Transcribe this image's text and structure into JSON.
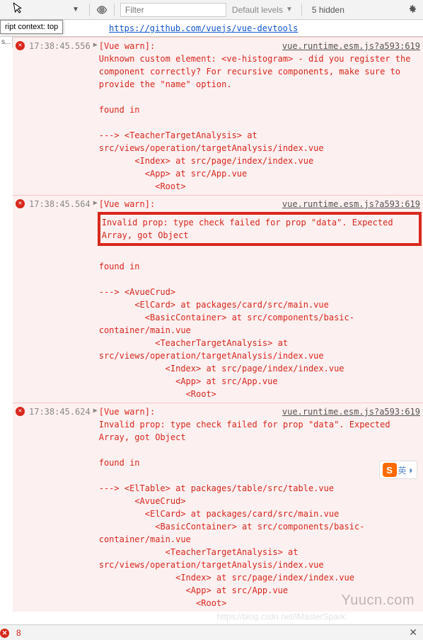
{
  "toolbar": {
    "filter_placeholder": "Filter",
    "levels_label": "Default levels",
    "hidden_label": "5 hidden"
  },
  "context": {
    "tooltip": "ript context: top",
    "sidebar_stub": "s...",
    "devtools_url": "https://github.com/vuejs/vue-devtools"
  },
  "messages": [
    {
      "timestamp": "17:38:45.556",
      "warn_label": "[Vue warn]:",
      "source": "vue.runtime.esm.js?a593:619",
      "body": "Unknown custom element: <ve-histogram> - did you register the component correctly? For recursive components, make sure to provide the \"name\" option.\n\nfound in\n\n---> <TeacherTargetAnalysis> at src/views/operation/targetAnalysis/index.vue\n       <Index> at src/page/index/index.vue\n         <App> at src/App.vue\n           <Root>",
      "highlight": ""
    },
    {
      "timestamp": "17:38:45.564",
      "warn_label": "[Vue warn]:",
      "source": "vue.runtime.esm.js?a593:619",
      "highlight": "Invalid prop: type check failed for prop \"data\". Expected Array, got Object",
      "body": "\nfound in\n\n---> <AvueCrud>\n       <ElCard> at packages/card/src/main.vue\n         <BasicContainer> at src/components/basic-container/main.vue\n           <TeacherTargetAnalysis> at src/views/operation/targetAnalysis/index.vue\n             <Index> at src/page/index/index.vue\n               <App> at src/App.vue\n                 <Root>"
    },
    {
      "timestamp": "17:38:45.624",
      "warn_label": "[Vue warn]:",
      "source": "vue.runtime.esm.js?a593:619",
      "highlight": "",
      "body": "Invalid prop: type check failed for prop \"data\". Expected Array, got Object\n\nfound in\n\n---> <ElTable> at packages/table/src/table.vue\n       <AvueCrud>\n         <ElCard> at packages/card/src/main.vue\n           <BasicContainer> at src/components/basic-container/main.vue\n             <TeacherTargetAnalysis> at src/views/operation/targetAnalysis/index.vue\n               <Index> at src/page/index/index.vue\n                 <App> at src/App.vue\n                   <Root>"
    }
  ],
  "ime": {
    "s": "S",
    "lang": "英"
  },
  "watermark": "Yuucn.com",
  "watermark2": "https://blog.csdn.net/iMasterSpark",
  "bottom": {
    "count": "8"
  }
}
